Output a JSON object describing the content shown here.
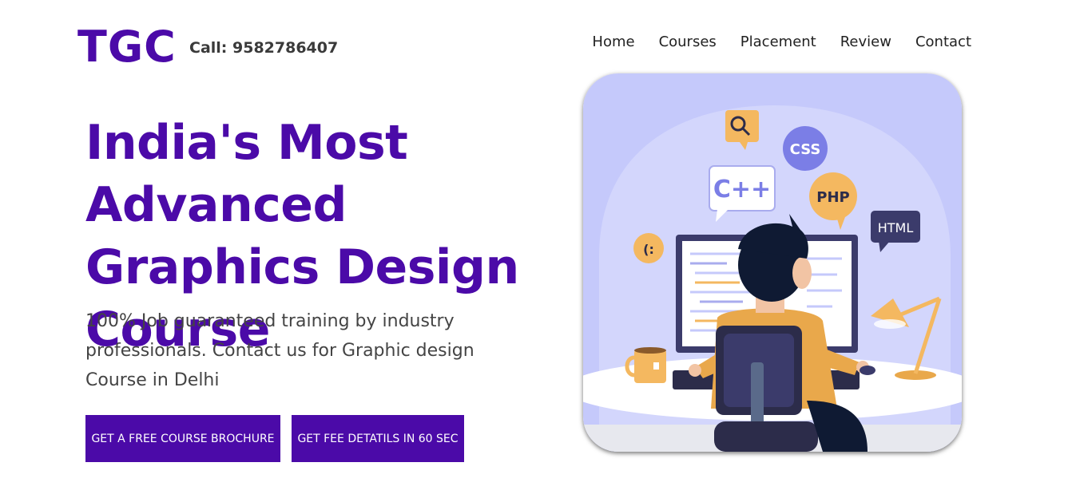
{
  "header": {
    "logo": "TGC",
    "phone": "Call: 9582786407"
  },
  "nav": {
    "items": [
      "Home",
      "Courses",
      "Placement",
      "Review",
      "Contact"
    ]
  },
  "hero": {
    "title": "India's Most Advanced Graphics Design Course",
    "description": "100% Job guaranteed training by industry professionals. Contact us for Graphic design Course in Delhi",
    "buttons": {
      "brochure": "GET A FREE COURSE BROCHURE",
      "fee": "GET FEE DETATILS IN 60 SEC"
    }
  },
  "illustration": {
    "bubbles": {
      "cpp": "C++",
      "css": "CSS",
      "php": "PHP",
      "html": "HTML",
      "smiley": "(:"
    }
  },
  "colors": {
    "brand": "#4b0aa8",
    "illustration_bg": "#c5c9fb"
  }
}
